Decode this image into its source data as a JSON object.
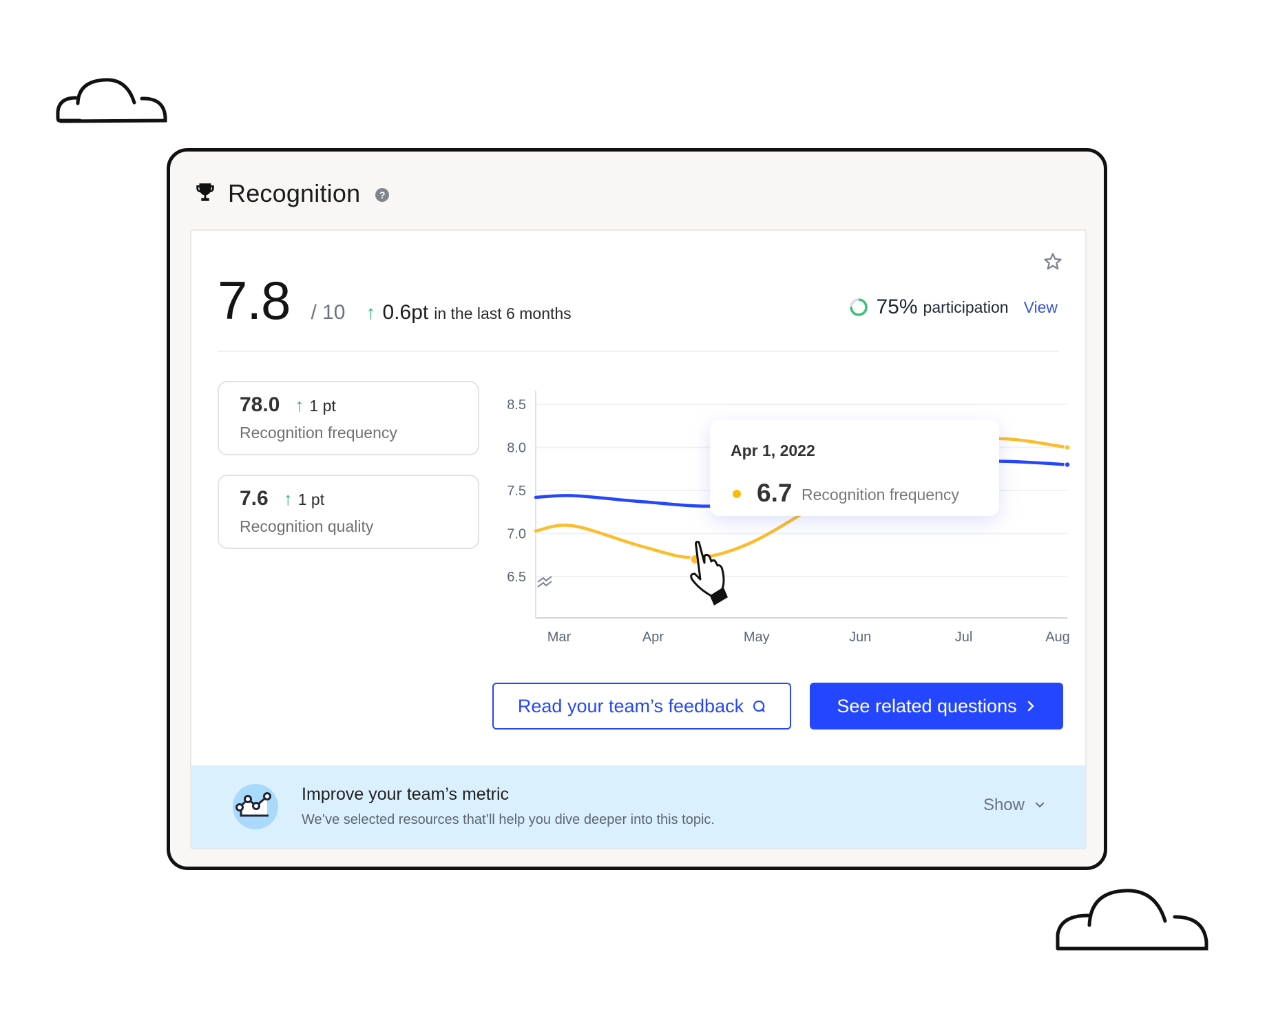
{
  "header": {
    "title": "Recognition",
    "title_icon": "trophy-icon",
    "help_icon": "question-circle-icon"
  },
  "summary": {
    "score": "7.8",
    "out_of": "/ 10",
    "delta_arrow": "↑",
    "delta_value": "0.6pt",
    "delta_period": "in the last 6 months",
    "participation_pct": "75%",
    "participation_fraction": 0.75,
    "participation_label": "participation",
    "view_link": "View",
    "favorite_icon": "star-outline-icon"
  },
  "metrics": [
    {
      "value": "78.0",
      "arrow": "↑",
      "delta": "1 pt",
      "label": "Recognition frequency"
    },
    {
      "value": "7.6",
      "arrow": "↑",
      "delta": "1 pt",
      "label": "Recognition quality"
    }
  ],
  "chart_data": {
    "type": "line",
    "categories": [
      "Mar",
      "Apr",
      "May",
      "Jun",
      "Jul",
      "Aug"
    ],
    "y_ticks": [
      "8.5",
      "8.0",
      "7.5",
      "7.0",
      "6.5"
    ],
    "ylim": [
      6.5,
      8.5
    ],
    "y_axis_break": true,
    "grid": true,
    "series": [
      {
        "name": "Recognition quality",
        "color": "#2446ff",
        "x": [
          0,
          0.35,
          1.0,
          1.7,
          2.4,
          3.0,
          3.6,
          4.3,
          5.0
        ],
        "values": [
          7.42,
          7.44,
          7.37,
          7.32,
          7.45,
          7.62,
          7.78,
          7.84,
          7.8
        ]
      },
      {
        "name": "Recognition frequency",
        "color": "#fbbd2e",
        "x": [
          0,
          0.35,
          1.0,
          1.5,
          2.0,
          2.6,
          3.2,
          3.8,
          4.4,
          5.0
        ],
        "values": [
          7.03,
          7.09,
          6.85,
          6.72,
          6.88,
          7.3,
          7.75,
          8.05,
          8.1,
          8.0
        ]
      }
    ],
    "highlight": {
      "series": "Recognition frequency",
      "x": 1.5,
      "value": 6.7
    },
    "tooltip": {
      "date": "Apr 1, 2022",
      "value": "6.7",
      "label": "Recognition frequency"
    }
  },
  "actions": {
    "feedback_button": "Read your team’s feedback",
    "related_button": "See related questions"
  },
  "banner": {
    "title": "Improve your team’s metric",
    "subtitle": "We’ve selected resources that’ll help you dive deeper into this topic.",
    "show_label": "Show"
  }
}
